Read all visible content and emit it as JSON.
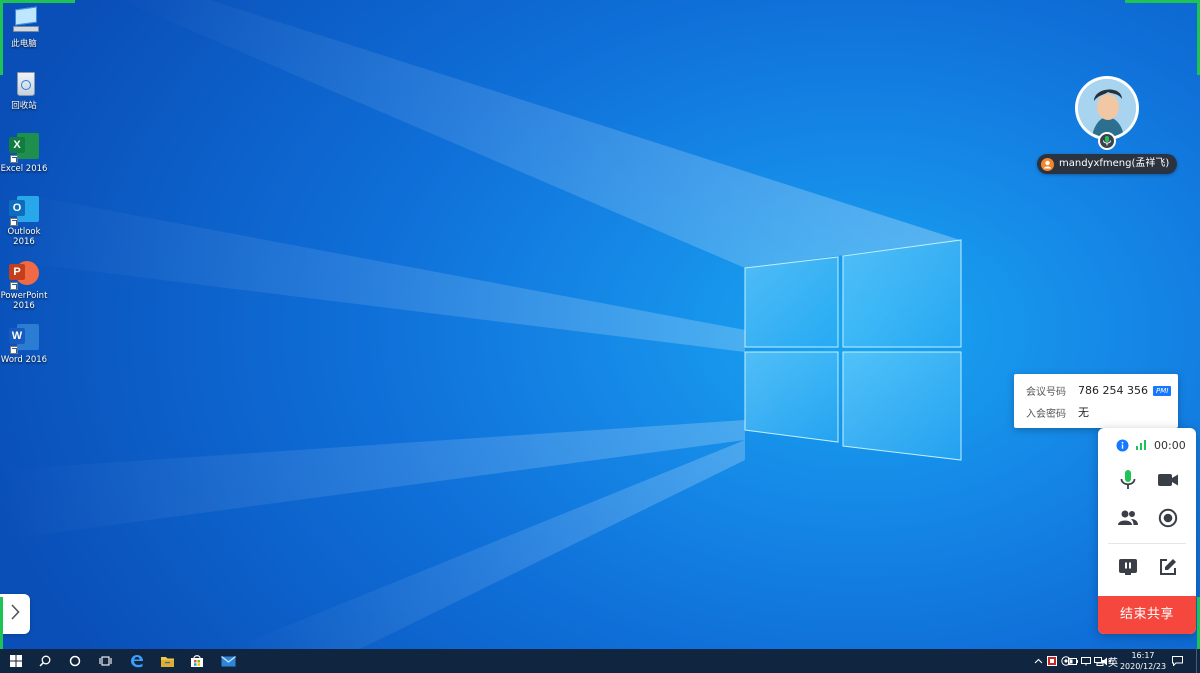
{
  "desktop_icons": [
    {
      "label": "此电脑"
    },
    {
      "label": "回收站"
    },
    {
      "label": "Excel 2016",
      "letter": "X"
    },
    {
      "label": "Outlook 2016",
      "letter": "O"
    },
    {
      "label": "PowerPoint 2016",
      "letter": "P"
    },
    {
      "label": "Word 2016",
      "letter": "W"
    }
  ],
  "presenter": {
    "name": "mandyxfmeng(孟祥飞)"
  },
  "meeting_info": {
    "id_label": "会议号码",
    "id_value": "786 254 356",
    "pmi_badge": "PMI",
    "password_label": "入会密码",
    "password_value": "无"
  },
  "panel": {
    "timer": "00:00",
    "end_share_label": "结束共享"
  },
  "taskbar": {
    "ime": "英",
    "time": "16:17",
    "date": "2020/12/23"
  },
  "colors": {
    "end_share": "#f5473e",
    "signal": "#1ec356",
    "info": "#1677ff",
    "taskbar": "#10253f"
  },
  "icons": [
    "windows-logo-icon",
    "search-icon",
    "cortana-icon",
    "task-view-icon",
    "edge-icon",
    "file-explorer-icon",
    "store-icon",
    "mail-icon",
    "microphone-icon",
    "video-camera-icon",
    "participants-icon",
    "record-icon",
    "pause-share-icon",
    "annotate-icon",
    "info-icon",
    "signal-icon",
    "chevron-right-icon",
    "notification-icon"
  ]
}
